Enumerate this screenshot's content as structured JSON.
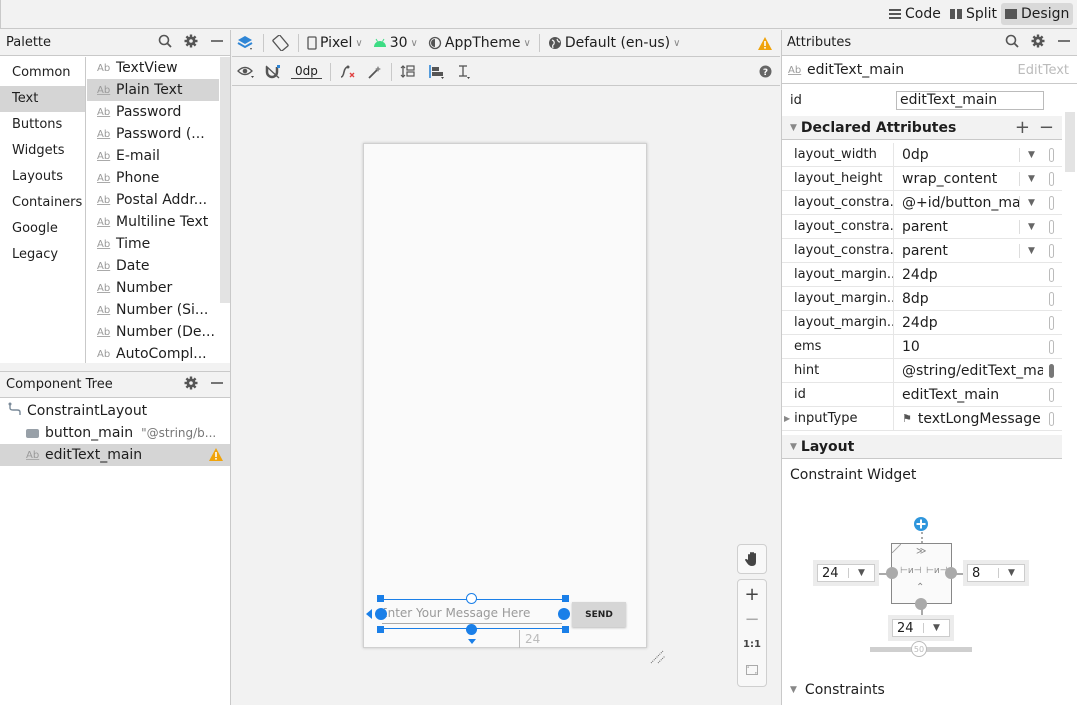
{
  "topbar": {
    "modes": [
      {
        "label": "Code",
        "icon": "code-lines-icon",
        "selected": false
      },
      {
        "label": "Split",
        "icon": "split-icon",
        "selected": false
      },
      {
        "label": "Design",
        "icon": "design-image-icon",
        "selected": true
      }
    ]
  },
  "palette": {
    "title": "Palette",
    "categories": [
      "Common",
      "Text",
      "Buttons",
      "Widgets",
      "Layouts",
      "Containers",
      "Google",
      "Legacy"
    ],
    "selected_category": "Text",
    "items": [
      "TextView",
      "Plain Text",
      "Password",
      "Password (...",
      "E-mail",
      "Phone",
      "Postal Addr...",
      "Multiline Text",
      "Time",
      "Date",
      "Number",
      "Number (Si...",
      "Number (De...",
      "AutoCompl..."
    ],
    "selected_item": "Plain Text",
    "icon_label": "Ab"
  },
  "component_tree": {
    "title": "Component Tree",
    "root": "ConstraintLayout",
    "children": [
      {
        "name": "button_main",
        "detail": "\"@string/b...",
        "selected": false,
        "warning": false
      },
      {
        "name": "editText_main",
        "detail": "",
        "selected": true,
        "warning": true
      }
    ]
  },
  "toolbar": {
    "device": "Pixel",
    "api": "30",
    "theme": "AppTheme",
    "locale": "Default (en-us)",
    "margin": "0dp"
  },
  "canvas": {
    "edittext_hint": "Enter Your Message Here",
    "button_label": "SEND",
    "margin_label": "24",
    "zoom_one_to_one": "1:1"
  },
  "attributes": {
    "title": "Attributes",
    "component_name": "editText_main",
    "component_type": "EditText",
    "id_label": "id",
    "id_value": "editText_main",
    "declared_title": "Declared Attributes",
    "declared": [
      {
        "name": "layout_width",
        "value": "0dp",
        "dropdown": true,
        "bound": false
      },
      {
        "name": "layout_height",
        "value": "wrap_content",
        "dropdown": true,
        "bound": false
      },
      {
        "name": "layout_constra...",
        "value": "@+id/button_ma",
        "dropdown": true,
        "bound": false
      },
      {
        "name": "layout_constra...",
        "value": "parent",
        "dropdown": true,
        "bound": false
      },
      {
        "name": "layout_constra...",
        "value": "parent",
        "dropdown": true,
        "bound": false
      },
      {
        "name": "layout_margin...",
        "value": "24dp",
        "dropdown": false,
        "bound": false
      },
      {
        "name": "layout_margin...",
        "value": "8dp",
        "dropdown": false,
        "bound": false
      },
      {
        "name": "layout_margin...",
        "value": "24dp",
        "dropdown": false,
        "bound": false
      },
      {
        "name": "ems",
        "value": "10",
        "dropdown": false,
        "bound": false
      },
      {
        "name": "hint",
        "value": "@string/editText_ma",
        "dropdown": false,
        "bound": true
      },
      {
        "name": "id",
        "value": "editText_main",
        "dropdown": false,
        "bound": false
      },
      {
        "name": "inputType",
        "value": "textLongMessage",
        "dropdown": false,
        "bound": false,
        "expandable": true,
        "flag": true
      }
    ],
    "layout_title": "Layout",
    "constraint_widget_title": "Constraint Widget",
    "constraint_widget": {
      "left_margin": "24",
      "right_margin": "8",
      "bottom_margin": "24",
      "bias": "50"
    },
    "constraints_title": "Constraints"
  },
  "colors": {
    "accent": "#1a7fe8",
    "warning": "#f0a30a",
    "android_green": "#3ddc84"
  }
}
